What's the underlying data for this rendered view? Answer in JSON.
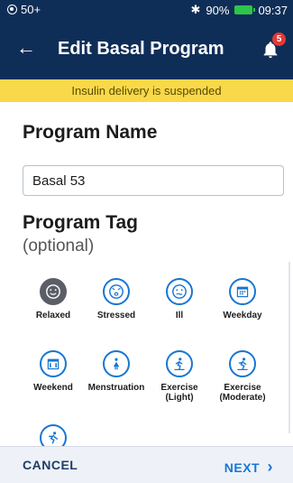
{
  "status_bar": {
    "left_text": "50+",
    "bluetooth": "✱",
    "battery_percent": "90%",
    "time": "09:37"
  },
  "app_bar": {
    "back_icon": "←",
    "title": "Edit Basal Program",
    "notification_count": "5"
  },
  "banner": {
    "text": "Insulin delivery is suspended"
  },
  "program_name": {
    "heading": "Program Name",
    "value": "Basal 53"
  },
  "program_tag": {
    "heading": "Program Tag",
    "optional": "(optional)",
    "tags": [
      {
        "label": "Relaxed",
        "selected": true,
        "icon": "relaxed-face-icon"
      },
      {
        "label": "Stressed",
        "icon": "stressed-face-icon"
      },
      {
        "label": "Ill",
        "icon": "ill-face-icon"
      },
      {
        "label": "Weekday",
        "icon": "calendar-weekday-icon"
      },
      {
        "label": "Weekend",
        "icon": "calendar-weekend-icon"
      },
      {
        "label": "Menstruation",
        "icon": "menstruation-icon"
      },
      {
        "label": "Exercise\n(Light)",
        "icon": "exercise-light-icon"
      },
      {
        "label": "Exercise\n(Moderate)",
        "icon": "exercise-moderate-icon"
      },
      {
        "label": "",
        "icon": "exercise-intense-icon"
      }
    ]
  },
  "footer": {
    "cancel": "CANCEL",
    "next": "NEXT",
    "next_icon": "›"
  },
  "colors": {
    "header": "#0f2e57",
    "banner": "#f9d94a",
    "accent": "#1976d2",
    "selected": "#5b5e68"
  }
}
